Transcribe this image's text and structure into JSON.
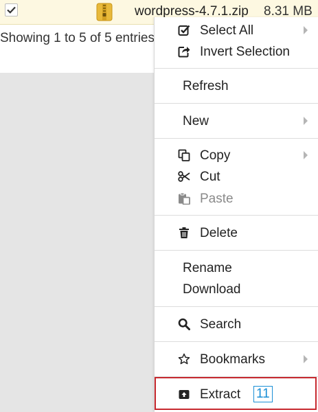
{
  "file_row": {
    "checked": true,
    "name": "wordpress-4.7.1.zip",
    "size": "8.31 MB"
  },
  "table_info": "Showing 1 to 5 of 5 entries",
  "menu": {
    "select_all": "Select All",
    "invert_selection": "Invert Selection",
    "refresh": "Refresh",
    "new": "New",
    "copy": "Copy",
    "cut": "Cut",
    "paste": "Paste",
    "delete": "Delete",
    "rename": "Rename",
    "download": "Download",
    "search": "Search",
    "bookmarks": "Bookmarks",
    "extract": "Extract",
    "extract_badge": "11"
  },
  "colors": {
    "highlight_border": "#c6282e",
    "badge": "#1a8fd6",
    "file_row_bg": "#fdf8e1"
  }
}
